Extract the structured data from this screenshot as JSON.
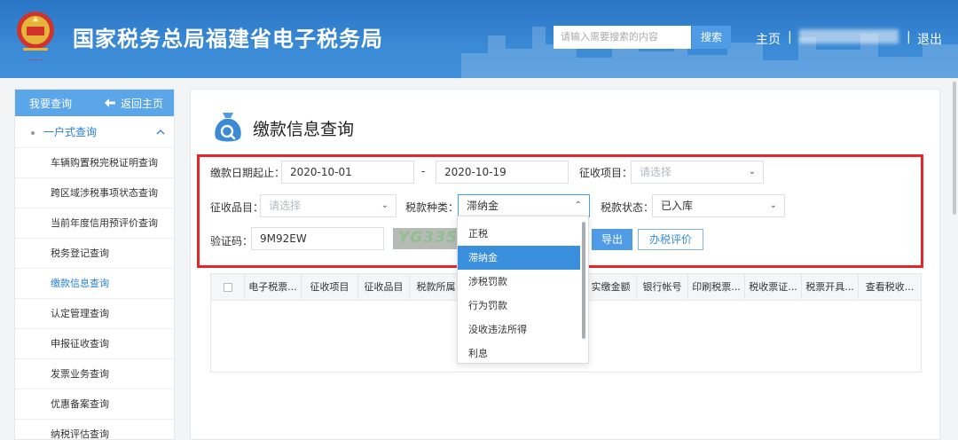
{
  "header": {
    "site_title": "国家税务总局福建省电子税务局",
    "search_placeholder": "请输入需要搜索的内容",
    "search_button": "搜索",
    "home_link": "主页",
    "separator": "|",
    "logout_link": "退出",
    "bg_color": "#3a8ad6"
  },
  "sidebar": {
    "header_title": "我要查询",
    "back_link": "返回主页",
    "group": "一户式查询",
    "items": [
      {
        "label": "车辆购置税完税证明查询"
      },
      {
        "label": "跨区域涉税事项状态查询"
      },
      {
        "label": "当前年度信用预评价查询"
      },
      {
        "label": "税务登记查询"
      },
      {
        "label": "缴款信息查询"
      },
      {
        "label": "认定管理查询"
      },
      {
        "label": "申报征收查询"
      },
      {
        "label": "发票业务查询"
      },
      {
        "label": "优惠备案查询"
      },
      {
        "label": "纳税评估查询"
      }
    ],
    "active_item": "缴款信息查询"
  },
  "main": {
    "title": "缴款信息查询",
    "form": {
      "date_range_label": "缴款日期起止：",
      "date_from": "2020-10-01",
      "date_sep": "-",
      "date_to": "2020-10-19",
      "levy_project_label": "征收项目：",
      "levy_project_placeholder": "请选择",
      "levy_item_label": "征收品目：",
      "levy_item_placeholder": "请选择",
      "tax_type_label": "税款种类：",
      "tax_type_value": "滞纳金",
      "tax_status_label": "税款状态：",
      "tax_status_value": "已入库",
      "captcha_label": "验证码：",
      "captcha_value": "9M92EW",
      "captcha_image_text": "YG335",
      "export_button": "导出",
      "eval_button": "办税评价"
    },
    "dropdown_options": [
      "正税",
      "滞纳金",
      "涉税罚款",
      "行为罚款",
      "没收违法所得",
      "利息"
    ],
    "dropdown_selected": "滞纳金",
    "table_headers": [
      "电子税票...",
      "征收项目",
      "征收品目",
      "税款所属",
      "",
      "实缴金额",
      "银行帐号",
      "印刷税票...",
      "税收票证...",
      "税票开具...",
      "查看税收..."
    ]
  }
}
